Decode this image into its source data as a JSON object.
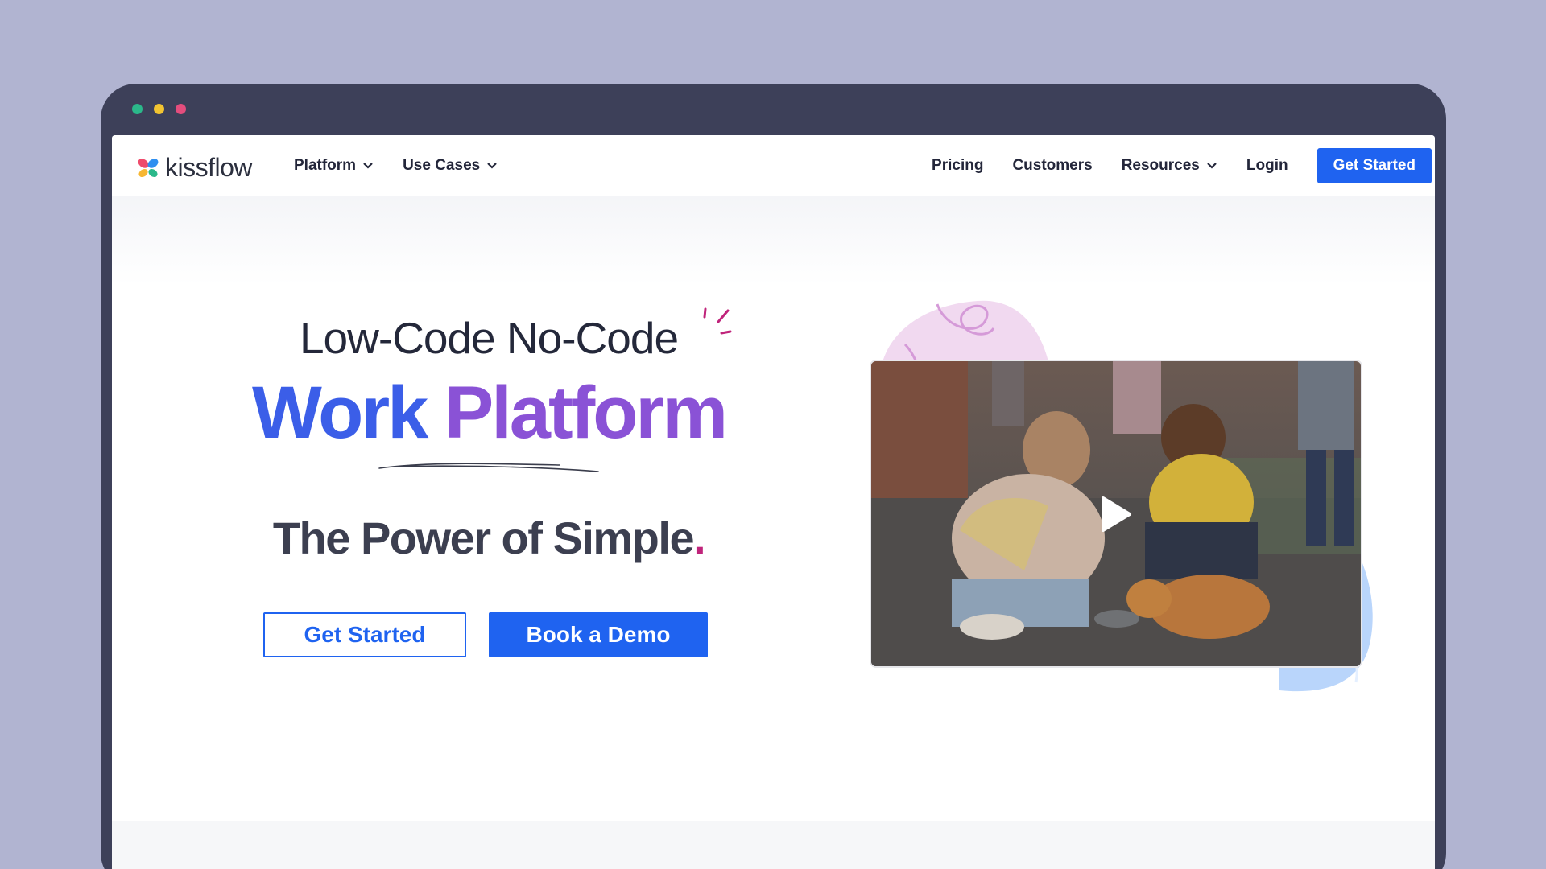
{
  "window": {
    "dots": [
      "#2bb88a",
      "#f2c431",
      "#e44d7d"
    ]
  },
  "brand": {
    "name": "kissflow"
  },
  "nav": {
    "left": [
      {
        "label": "Platform",
        "dropdown": true
      },
      {
        "label": "Use Cases",
        "dropdown": true
      }
    ],
    "right": [
      {
        "label": "Pricing",
        "dropdown": false
      },
      {
        "label": "Customers",
        "dropdown": false
      },
      {
        "label": "Resources",
        "dropdown": true
      },
      {
        "label": "Login",
        "dropdown": false
      }
    ],
    "cta": "Get Started"
  },
  "hero": {
    "eyebrow": "Low-Code No-Code",
    "headline_word1": "Work",
    "headline_word2": "Platform",
    "tagline": "The Power of Simple",
    "tagline_period": ".",
    "primary_button": "Get Started",
    "secondary_button": "Book a Demo"
  },
  "video": {
    "icon": "play-icon"
  },
  "colors": {
    "accent": "#1f63f0",
    "gradient_start": "#3b5ee8",
    "gradient_end": "#8a52d6",
    "background": "#b1b4d1",
    "frame": "#3d4059",
    "period": "#c0247b"
  }
}
